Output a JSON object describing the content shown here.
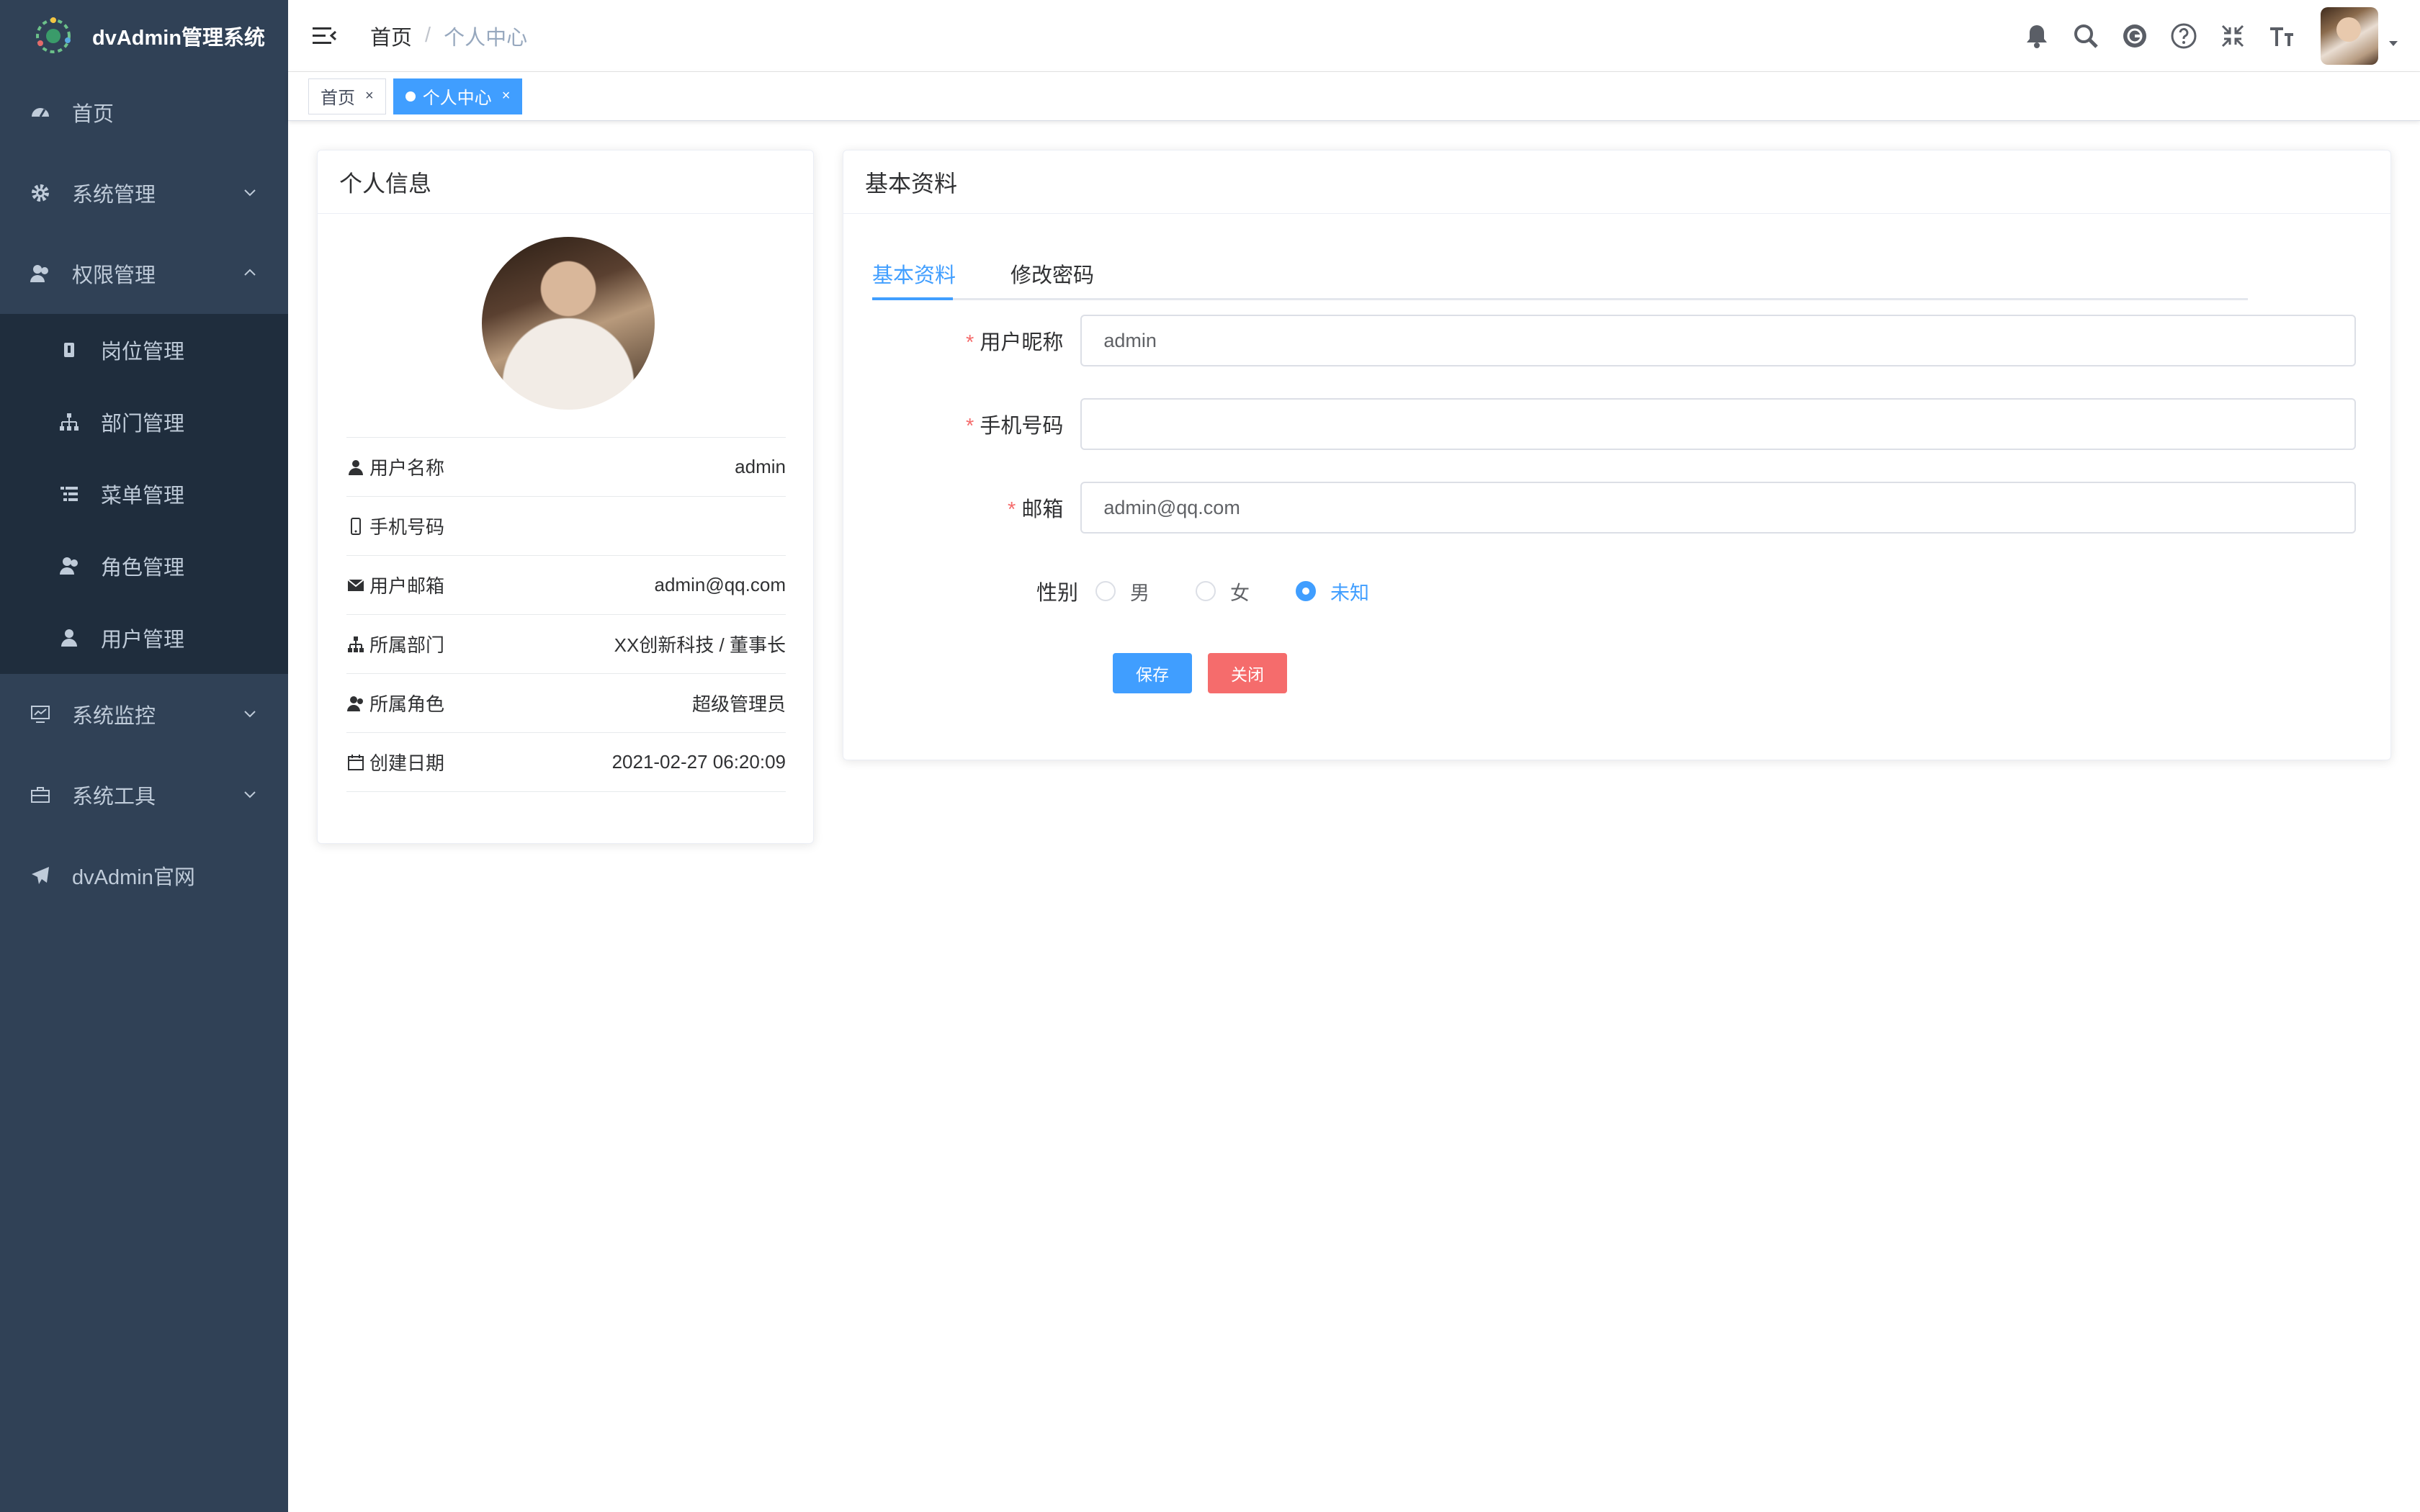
{
  "sidebar": {
    "logo_text": "dvAdmin管理系统",
    "items": [
      {
        "label": "首页",
        "icon": "dashboard-icon"
      },
      {
        "label": "系统管理",
        "icon": "gear-icon"
      },
      {
        "label": "权限管理",
        "icon": "users-icon"
      },
      {
        "label": "系统监控",
        "icon": "monitor-icon"
      },
      {
        "label": "系统工具",
        "icon": "toolbox-icon"
      },
      {
        "label": "dvAdmin官网",
        "icon": "paper-plane-icon"
      }
    ],
    "submenu": [
      {
        "label": "岗位管理",
        "icon": "badge-icon"
      },
      {
        "label": "部门管理",
        "icon": "tree-icon"
      },
      {
        "label": "菜单管理",
        "icon": "list-icon"
      },
      {
        "label": "角色管理",
        "icon": "role-icon"
      },
      {
        "label": "用户管理",
        "icon": "user-icon"
      }
    ]
  },
  "navbar": {
    "breadcrumb_home": "首页",
    "breadcrumb_sep": "/",
    "breadcrumb_current": "个人中心"
  },
  "tags": [
    {
      "label": "首页",
      "close": "×"
    },
    {
      "label": "个人中心",
      "close": "×"
    }
  ],
  "profile": {
    "title": "个人信息",
    "rows": [
      {
        "label": "用户名称",
        "value": "admin"
      },
      {
        "label": "手机号码",
        "value": ""
      },
      {
        "label": "用户邮箱",
        "value": "admin@qq.com"
      },
      {
        "label": "所属部门",
        "value": "XX创新科技 / 董事长"
      },
      {
        "label": "所属角色",
        "value": "超级管理员"
      },
      {
        "label": "创建日期",
        "value": "2021-02-27 06:20:09"
      }
    ]
  },
  "basic": {
    "title": "基本资料",
    "tabs": [
      "基本资料",
      "修改密码"
    ],
    "fields": {
      "nickname_label": "用户昵称",
      "nickname_value": "admin",
      "phone_label": "手机号码",
      "phone_value": "",
      "email_label": "邮箱",
      "email_value": "admin@qq.com",
      "gender_label": "性别",
      "gender_options": [
        "男",
        "女",
        "未知"
      ],
      "required_mark": "*"
    },
    "save_label": "保存",
    "close_label": "关闭"
  },
  "colors": {
    "sidebar_bg": "#304156",
    "submenu_bg": "#1f2d3d",
    "primary": "#409eff",
    "danger": "#f56c6c"
  }
}
